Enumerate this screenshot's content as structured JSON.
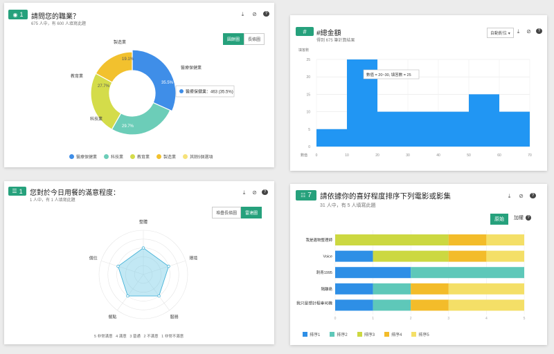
{
  "card1": {
    "badge_num": "1",
    "title": "請問您的職業？",
    "subtitle": "675 人中，有 600 人填寫此題",
    "toggle": [
      "圓餅圖",
      "長條圖"
    ],
    "tooltip": "醫療保健業：463 (35.5%)",
    "slice_labels": [
      "醫療保健業",
      "科技業",
      "教育業",
      "製造業"
    ],
    "slice_pcts": [
      "35.5%",
      "29.7%",
      "27.7%",
      "19.1%"
    ],
    "legend": [
      "醫療保健業",
      "科技業",
      "教育業",
      "製造業",
      "其餘5個選項"
    ]
  },
  "card2": {
    "badge": "#",
    "title": "#總金額",
    "subtitle": "得到 675 筆計算結果",
    "dropdown": "自動對位",
    "y_unit": "填答數",
    "x_unit": "數值",
    "tooltip": "數值 = 20~30, 填答數 = 25",
    "y_ticks": [
      "25",
      "20",
      "15",
      "10",
      "5",
      "0"
    ],
    "x_ticks": [
      "0",
      "10",
      "20",
      "30",
      "40",
      "50",
      "60",
      "70"
    ]
  },
  "card3": {
    "badge_num": "1",
    "title": "您對於今日用餐的滿意程度：",
    "subtitle": "1 人中，有 1 人填寫此題",
    "toggle": [
      "堆疊長條圖",
      "雷達圖"
    ],
    "axes": [
      "整體",
      "環境",
      "服務",
      "餐點",
      "價位"
    ],
    "scale_legend": "5 非常滿意   4 滿意   3 普通   2 不滿意   1 非常不滿意"
  },
  "card4": {
    "badge_num": "7",
    "title": "請依據你的喜好程度排序下列電影或影集",
    "subtitle": "31 人中，有 5 人填寫此題",
    "btn_primary": "原始",
    "btn_secondary": "加權",
    "rows": [
      "我是遺物整理師",
      "Voice",
      "刺青1995",
      "隔離島",
      "我只是想計程車司機"
    ],
    "x_ticks": [
      "0",
      "1",
      "2",
      "3",
      "4",
      "5"
    ],
    "legend": [
      "排序1",
      "排序2",
      "排序3",
      "排序4",
      "排序5"
    ]
  },
  "chart_data": [
    {
      "type": "pie",
      "title": "請問您的職業？",
      "labels": [
        "醫療保健業",
        "科技業",
        "教育業",
        "製造業",
        "其餘5個選項"
      ],
      "values": [
        35.5,
        29.7,
        27.7,
        19.1,
        0
      ],
      "colors": [
        "#3f8ee8",
        "#6ccdb8",
        "#d4dc4a",
        "#f2c12e",
        "#f6e27a"
      ]
    },
    {
      "type": "bar",
      "title": "#總金額",
      "xlabel": "數值",
      "ylabel": "填答數",
      "categories": [
        "0-10",
        "10-20",
        "20-30",
        "30-40",
        "40-50",
        "50-60",
        "60-70"
      ],
      "values": [
        5,
        25,
        10,
        10,
        10,
        15,
        10
      ],
      "ylim": [
        0,
        25
      ],
      "color": "#2196f3"
    },
    {
      "type": "radar",
      "title": "您對於今日用餐的滿意程度：",
      "categories": [
        "整體",
        "環境",
        "服務",
        "餐點",
        "價位"
      ],
      "values": [
        3,
        3,
        3,
        3,
        3
      ],
      "rmax": 5
    },
    {
      "type": "bar",
      "title": "請依據你的喜好程度排序下列電影或影集",
      "categories": [
        "我是遺物整理師",
        "Voice",
        "刺青1995",
        "隔離島",
        "我只是想計程車司機"
      ],
      "series": [
        {
          "name": "排序1",
          "values": [
            0,
            1,
            2,
            1,
            1
          ],
          "color": "#2e8fe6"
        },
        {
          "name": "排序2",
          "values": [
            0,
            0,
            3,
            1,
            1
          ],
          "color": "#5ec8b9"
        },
        {
          "name": "排序3",
          "values": [
            3,
            2,
            0,
            0,
            0
          ],
          "color": "#ccd841"
        },
        {
          "name": "排序4",
          "values": [
            1,
            1,
            0,
            1,
            1
          ],
          "color": "#f3bc2a"
        },
        {
          "name": "排序5",
          "values": [
            1,
            1,
            0,
            2,
            2
          ],
          "color": "#f4df67"
        }
      ],
      "xlim": [
        0,
        5
      ]
    }
  ]
}
